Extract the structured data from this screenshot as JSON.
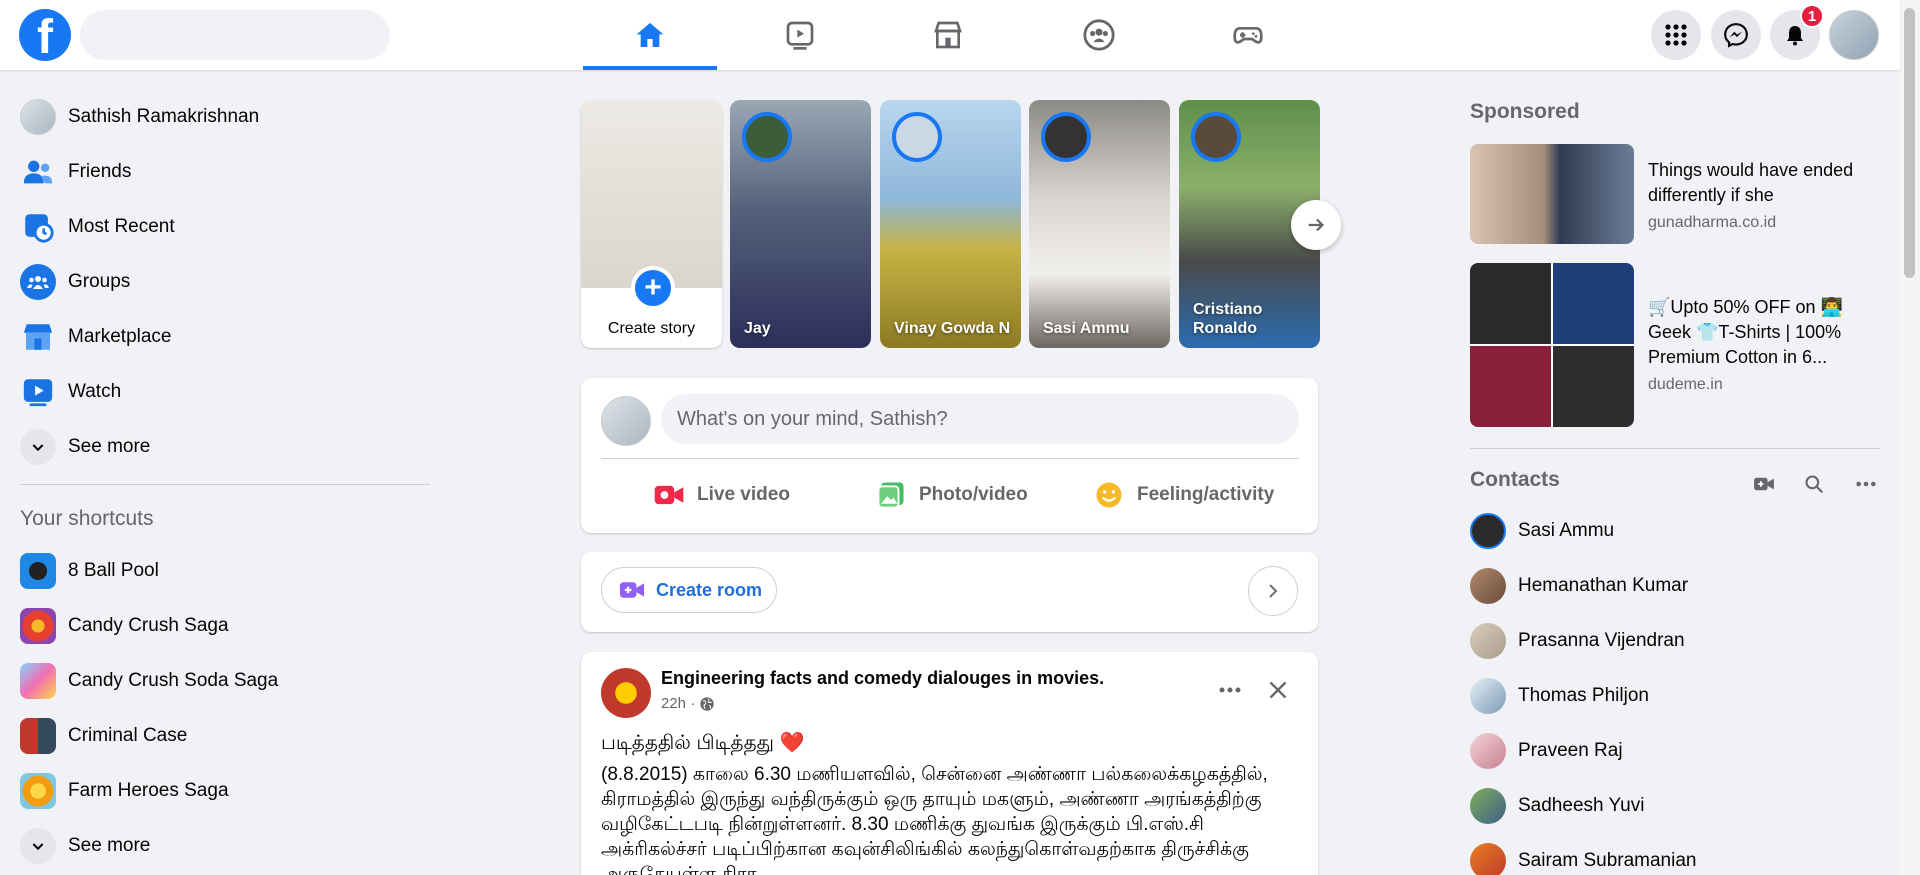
{
  "top_nav": {
    "tabs": [
      {
        "name": "home",
        "active": true
      },
      {
        "name": "watch",
        "active": false
      },
      {
        "name": "marketplace",
        "active": false
      },
      {
        "name": "groups",
        "active": false
      },
      {
        "name": "gaming",
        "active": false
      }
    ],
    "notification_count": "1",
    "icons": [
      "menu-grid-icon",
      "messenger-icon",
      "bell-icon"
    ]
  },
  "left_sidebar": {
    "profile_name": "Sathish Ramakrishnan",
    "items": [
      {
        "label": "Friends",
        "icon": "friends-icon"
      },
      {
        "label": "Most Recent",
        "icon": "most-recent-icon"
      },
      {
        "label": "Groups",
        "icon": "groups-icon"
      },
      {
        "label": "Marketplace",
        "icon": "marketplace-icon"
      },
      {
        "label": "Watch",
        "icon": "watch-icon"
      }
    ],
    "see_more": "See more",
    "shortcuts_title": "Your shortcuts",
    "shortcuts": [
      {
        "label": "8 Ball Pool"
      },
      {
        "label": "Candy Crush Saga"
      },
      {
        "label": "Candy Crush Soda Saga"
      },
      {
        "label": "Criminal Case"
      },
      {
        "label": "Farm Heroes Saga"
      }
    ],
    "shortcuts_see_more": "See more"
  },
  "stories": {
    "create_label": "Create story",
    "items": [
      {
        "name": "Jay"
      },
      {
        "name": "Vinay Gowda N"
      },
      {
        "name": "Sasi Ammu"
      },
      {
        "name": "Cristiano Ronaldo"
      }
    ]
  },
  "composer": {
    "placeholder": "What's on your mind, Sathish?",
    "actions": [
      {
        "label": "Live video",
        "icon": "live-video-icon",
        "color": "#f02849"
      },
      {
        "label": "Photo/video",
        "icon": "photo-icon",
        "color": "#45bd62"
      },
      {
        "label": "Feeling/activity",
        "icon": "feeling-icon",
        "color": "#f7b928"
      }
    ]
  },
  "room": {
    "create_label": "Create room"
  },
  "post": {
    "page_name": "Engineering facts and comedy dialouges in movies.",
    "time": "22h ·",
    "heading": "படித்ததில் பிடித்தது ❤️",
    "body": "(8.8.2015) காலை 6.30 மணியளவில், சென்னை அண்ணா பல்கலைக்கழகத்தில், கிராமத்தில் இருந்து வந்திருக்கும் ஒரு தாயும் மகளும், அண்ணா அரங்கத்திற்கு வழிகேட்டபடி நின்றுள்ளனர். 8.30 மணிக்கு துவங்க இருக்கும் பி.எஸ்.சி அக்ரிகல்ச்சர் படிப்பிற்கான கவுன்சிலிங்கில் கலந்துகொள்வதற்காக திருச்சிக்கு அருகேயுள்ள கிரா"
  },
  "right_column": {
    "sponsored_title": "Sponsored",
    "ads": [
      {
        "text": "Things would have ended differently if she",
        "domain": "gunadharma.co.id"
      },
      {
        "text": "🛒Upto 50% OFF on 👨‍💻 Geek 👕T-Shirts | 100% Premium Cotton in 6...",
        "domain": "dudeme.in"
      }
    ],
    "contacts_title": "Contacts",
    "contacts": [
      {
        "name": "Sasi Ammu"
      },
      {
        "name": "Hemanathan Kumar"
      },
      {
        "name": "Prasanna Vijendran"
      },
      {
        "name": "Thomas Philjon"
      },
      {
        "name": "Praveen Raj"
      },
      {
        "name": "Sadheesh Yuvi"
      },
      {
        "name": "Sairam Subramanian"
      }
    ]
  },
  "colors": {
    "brand": "#1877f2",
    "background": "#f0f2f5",
    "badge": "#e41e3f"
  }
}
